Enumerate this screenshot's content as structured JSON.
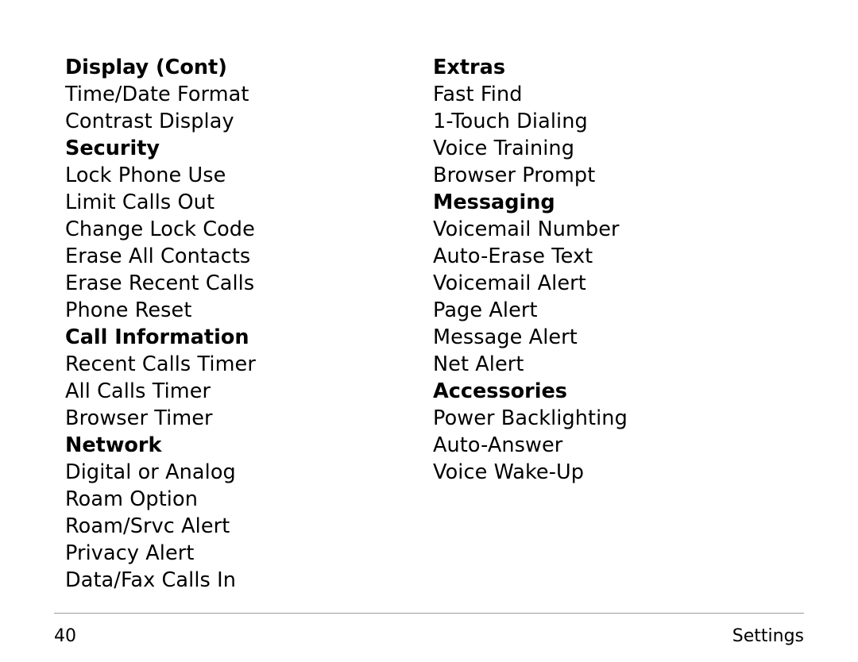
{
  "page": {
    "background_color": "#ffffff",
    "text_color": "#000000",
    "rule_color": "#9a9a9a"
  },
  "columns": [
    {
      "name": "left-column",
      "lines": [
        {
          "text": "Display (Cont)",
          "type": "heading"
        },
        {
          "text": "Time/Date Format",
          "type": "item"
        },
        {
          "text": "Contrast Display",
          "type": "item"
        },
        {
          "text": "Security",
          "type": "heading"
        },
        {
          "text": "Lock Phone Use",
          "type": "item"
        },
        {
          "text": "Limit Calls Out",
          "type": "item"
        },
        {
          "text": "Change Lock Code",
          "type": "item"
        },
        {
          "text": "Erase All Contacts",
          "type": "item"
        },
        {
          "text": "Erase Recent Calls",
          "type": "item"
        },
        {
          "text": "Phone Reset",
          "type": "item"
        },
        {
          "text": "Call Information",
          "type": "heading"
        },
        {
          "text": "Recent Calls Timer",
          "type": "item"
        },
        {
          "text": "All Calls Timer",
          "type": "item"
        },
        {
          "text": "Browser Timer",
          "type": "item"
        },
        {
          "text": "Network",
          "type": "heading"
        },
        {
          "text": "Digital or Analog",
          "type": "item"
        },
        {
          "text": "Roam Option",
          "type": "item"
        },
        {
          "text": "Roam/Srvc Alert",
          "type": "item"
        },
        {
          "text": "Privacy Alert",
          "type": "item"
        },
        {
          "text": "Data/Fax Calls In",
          "type": "item"
        }
      ]
    },
    {
      "name": "right-column",
      "lines": [
        {
          "text": "Extras",
          "type": "heading"
        },
        {
          "text": "Fast Find",
          "type": "item"
        },
        {
          "text": "1-Touch Dialing",
          "type": "item"
        },
        {
          "text": "Voice Training",
          "type": "item"
        },
        {
          "text": "Browser Prompt",
          "type": "item"
        },
        {
          "text": "Messaging",
          "type": "heading"
        },
        {
          "text": "Voicemail Number",
          "type": "item"
        },
        {
          "text": "Auto-Erase Text",
          "type": "item"
        },
        {
          "text": "Voicemail Alert",
          "type": "item"
        },
        {
          "text": "Page Alert",
          "type": "item"
        },
        {
          "text": "Message Alert",
          "type": "item"
        },
        {
          "text": "Net Alert",
          "type": "item"
        },
        {
          "text": "Accessories",
          "type": "heading"
        },
        {
          "text": "Power Backlighting",
          "type": "item"
        },
        {
          "text": "Auto-Answer",
          "type": "item"
        },
        {
          "text": "Voice Wake-Up",
          "type": "item"
        }
      ]
    }
  ],
  "footer": {
    "page_number": "40",
    "section_label": "Settings"
  }
}
